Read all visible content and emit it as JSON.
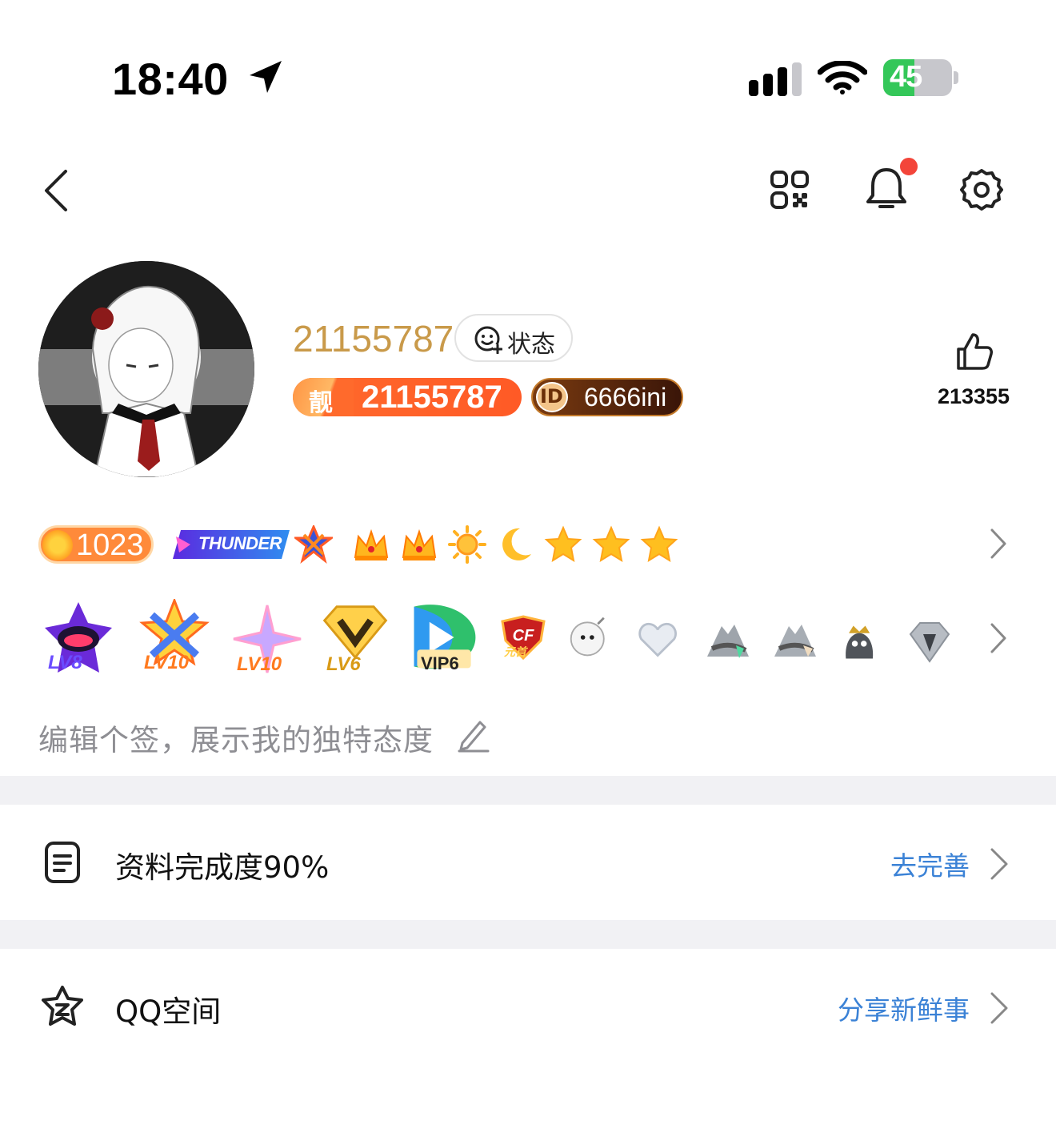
{
  "status_bar": {
    "time": "18:40",
    "battery_text": "45",
    "battery_level": 0.45
  },
  "nav": {
    "back_icon": "chevron-left-icon",
    "qr_icon": "qr-code-icon",
    "bell_icon": "bell-icon",
    "settings_icon": "gear-icon"
  },
  "profile": {
    "nickname": "21155787",
    "status_label": "状态",
    "pretty_number_tag": "靓",
    "pretty_number": "21155787",
    "id_badge_tag": "ID",
    "id_badge_text": "6666ini",
    "likes": "213355"
  },
  "badges_row1": {
    "level_points": "1023",
    "thunder_label": "THUNDER",
    "rank_icons": [
      "crown-icon",
      "crown-icon",
      "sun-icon",
      "moon-icon",
      "star-icon",
      "star-icon",
      "star-icon"
    ]
  },
  "badges_row2": {
    "items": [
      {
        "icon": "lv8-badge-icon",
        "label": "LV8"
      },
      {
        "icon": "lv10-badge-icon",
        "label": "LV10"
      },
      {
        "icon": "lv10-sparkle-badge-icon",
        "label": "LV10"
      },
      {
        "icon": "diamond-v-badge-icon",
        "label": "LV6"
      },
      {
        "icon": "video-vip-icon",
        "label": "VIP6"
      },
      {
        "icon": "cf-game-icon",
        "label": "元首"
      },
      {
        "icon": "bomb-face-icon",
        "label": ""
      },
      {
        "icon": "heart-icon",
        "label": ""
      },
      {
        "icon": "mountain-gem-icon",
        "label": ""
      },
      {
        "icon": "mountain-icon",
        "label": ""
      },
      {
        "icon": "penguin-crown-icon",
        "label": ""
      },
      {
        "icon": "diamond-icon",
        "label": ""
      }
    ]
  },
  "signature": {
    "placeholder": "编辑个签，展示我的独特态度"
  },
  "list": {
    "profile_completion": {
      "label": "资料完成度90%",
      "action": "去完善"
    },
    "qzone": {
      "label": "QQ空间",
      "action": "分享新鲜事"
    }
  },
  "colors": {
    "nickname": "#c99a4a",
    "accent_blue": "#3b82d6",
    "badge_orange": "#ff5a26",
    "notification_dot": "#f3453a",
    "battery_green": "#34c759"
  }
}
